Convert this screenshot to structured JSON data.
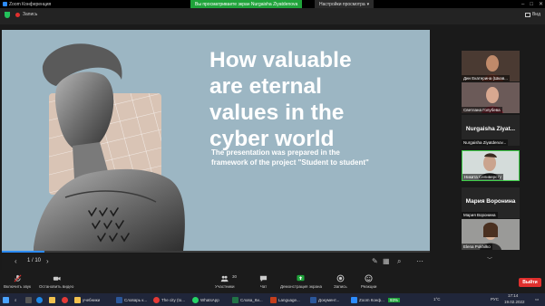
{
  "window": {
    "title": "Zoom Конференция"
  },
  "banner": {
    "share_text": "Вы просматриваете экран Nurgaisha Ziyatdenova",
    "view_options": "Настройки просмотра"
  },
  "top": {
    "record_label": "Запись",
    "view_label": "Вид"
  },
  "slide": {
    "title": "How valuable\nare eternal\nvalues in the\ncyber world",
    "subtitle": "The presentation was prepared in the framework of the project \"Student to student\"",
    "page": "1 / 10",
    "progress": 0.1
  },
  "participants": [
    {
      "name": "Дин Екатерина (Шкав..."
    },
    {
      "name": "Светлана Голубева"
    },
    {
      "name": "Nurgaisha Ziyatdenov...",
      "display": "Nurgaisha Ziyat..."
    },
    {
      "name": "Никита Селиверсту"
    },
    {
      "name": "Мария Воронина",
      "display": "Мария Воронина"
    },
    {
      "name": "Elena Pokhilko"
    }
  ],
  "toolbar": {
    "mute": "Включить звук",
    "video": "Остановить видео",
    "participants": "Участники",
    "participants_count": "30",
    "chat": "Чат",
    "share": "Демонстрация экрана",
    "record": "Запись",
    "reactions": "Реакции",
    "leave": "Выйти"
  },
  "taskbar": {
    "items": [
      "учебники",
      "Словарь к...",
      "The city (to...",
      "WhatsApp",
      "Слова_Ки...",
      "Language...",
      "Документ...",
      "Zoom Конф..."
    ],
    "battery": "93%",
    "temp": "1°C",
    "lang": "РУС",
    "time": "17:14",
    "date": "19.02.2022"
  },
  "colors": {
    "slide_bg": "#9cb6c3",
    "share_green": "#1fa33a",
    "leave_red": "#e0302e",
    "accent": "#2d8cff"
  }
}
